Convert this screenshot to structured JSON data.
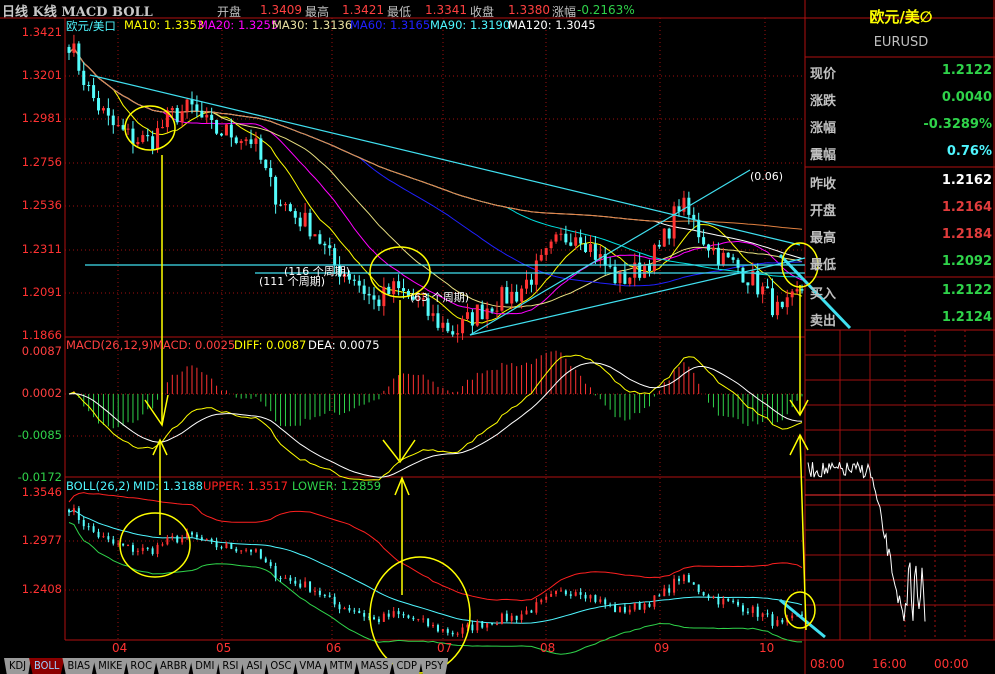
{
  "header": {
    "title": "日线 K线 MACD BOLL",
    "open_label": "开盘",
    "open": "1.3409",
    "high_label": "最高",
    "high": "1.3421",
    "low_label": "最低",
    "low": "1.3341",
    "close_label": "收盘",
    "close": "1.3380",
    "change_label": "涨幅",
    "change": "-0.2163%"
  },
  "price_legend": {
    "symbol": "欧元/美口",
    "ma10": "MA10: 1.3353",
    "ma20": "MA20: 1.3255",
    "ma30": "MA30: 1.3136",
    "ma60": "MA60: 1.3165",
    "ma90": "MA90: 1.3190",
    "ma120": "MA120: 1.3045"
  },
  "price_axis": [
    "1.3421",
    "1.3201",
    "1.2981",
    "1.2756",
    "1.2536",
    "1.2311",
    "1.2091",
    "1.1866"
  ],
  "macd_legend": {
    "name": "MACD(26,12,9)",
    "macd": "MACD: 0.0025",
    "diff": "DIFF: 0.0087",
    "dea": "DEA: 0.0075"
  },
  "macd_axis": [
    "0.0087",
    "0.0002",
    "-0.0085",
    "-0.0172"
  ],
  "boll_legend": {
    "name": "BOLL(26,2)",
    "mid": "MID: 1.3188",
    "upper": "UPPER: 1.3517",
    "lower": "LOWER: 1.2859"
  },
  "boll_axis": [
    "1.3546",
    "1.2977",
    "1.2408"
  ],
  "annotations": {
    "p116": "(116 个周期)",
    "p111": "(111 个周期)",
    "p63": "(63 个周期)",
    "ch": "(0.06)"
  },
  "date_axis": [
    "04",
    "05",
    "06",
    "07",
    "08",
    "09",
    "10"
  ],
  "price_path": [
    1.338,
    1.312,
    1.296,
    1.289,
    1.287,
    1.3,
    1.304,
    1.293,
    1.291,
    1.288,
    1.262,
    1.25,
    1.243,
    1.224,
    1.218,
    1.205,
    1.212,
    1.206,
    1.196,
    1.19,
    1.2,
    1.206,
    1.21,
    1.222,
    1.236,
    1.242,
    1.228,
    1.216,
    1.222,
    1.232,
    1.256,
    1.24,
    1.228,
    1.222,
    1.212,
    1.198,
    1.2122
  ],
  "quote_panel": {
    "name": "欧元/美∅",
    "code": "EURUSD",
    "rows": [
      {
        "label": "现价",
        "value": "1.2122",
        "color": "#2fd34a"
      },
      {
        "label": "涨跌",
        "value": "0.0040",
        "color": "#2fd34a"
      },
      {
        "label": "涨幅",
        "value": "-0.3289%",
        "color": "#2fd34a"
      },
      {
        "label": "震幅",
        "value": "0.76%",
        "color": "#4ff6ff"
      },
      {
        "label": "昨收",
        "value": "1.2162",
        "color": "#ffffff"
      },
      {
        "label": "开盘",
        "value": "1.2164",
        "color": "#e03c3c"
      },
      {
        "label": "最高",
        "value": "1.2184",
        "color": "#e03c3c"
      },
      {
        "label": "最低",
        "value": "1.2092",
        "color": "#2fd34a"
      },
      {
        "label": "买入",
        "value": "1.2122",
        "color": "#2fd34a"
      },
      {
        "label": "卖出",
        "value": "1.2124",
        "color": "#2fd34a"
      }
    ]
  },
  "intraday_axis": [
    "08:00",
    "16:00",
    "00:00"
  ],
  "tabs": [
    {
      "label": "KDJ"
    },
    {
      "label": "BOLL",
      "active": true
    },
    {
      "label": "BIAS"
    },
    {
      "label": "MIKE"
    },
    {
      "label": "ROC"
    },
    {
      "label": "ARBR"
    },
    {
      "label": "DMI"
    },
    {
      "label": "RSI"
    },
    {
      "label": "ASI"
    },
    {
      "label": "OSC"
    },
    {
      "label": "VMA"
    },
    {
      "label": "MTM"
    },
    {
      "label": "MASS"
    },
    {
      "label": "CDP"
    },
    {
      "label": "PSY"
    }
  ],
  "colors": {
    "up": "#ff3232",
    "down": "#54fcfc",
    "frame": "#b01010",
    "ma10": "#ffff00",
    "ma20": "#ff00ff",
    "ma30": "#e8e080",
    "ma60": "#2020ff",
    "ma90": "#00e0e0",
    "ma120": "#ffffff",
    "annotation": "#ffff00"
  }
}
